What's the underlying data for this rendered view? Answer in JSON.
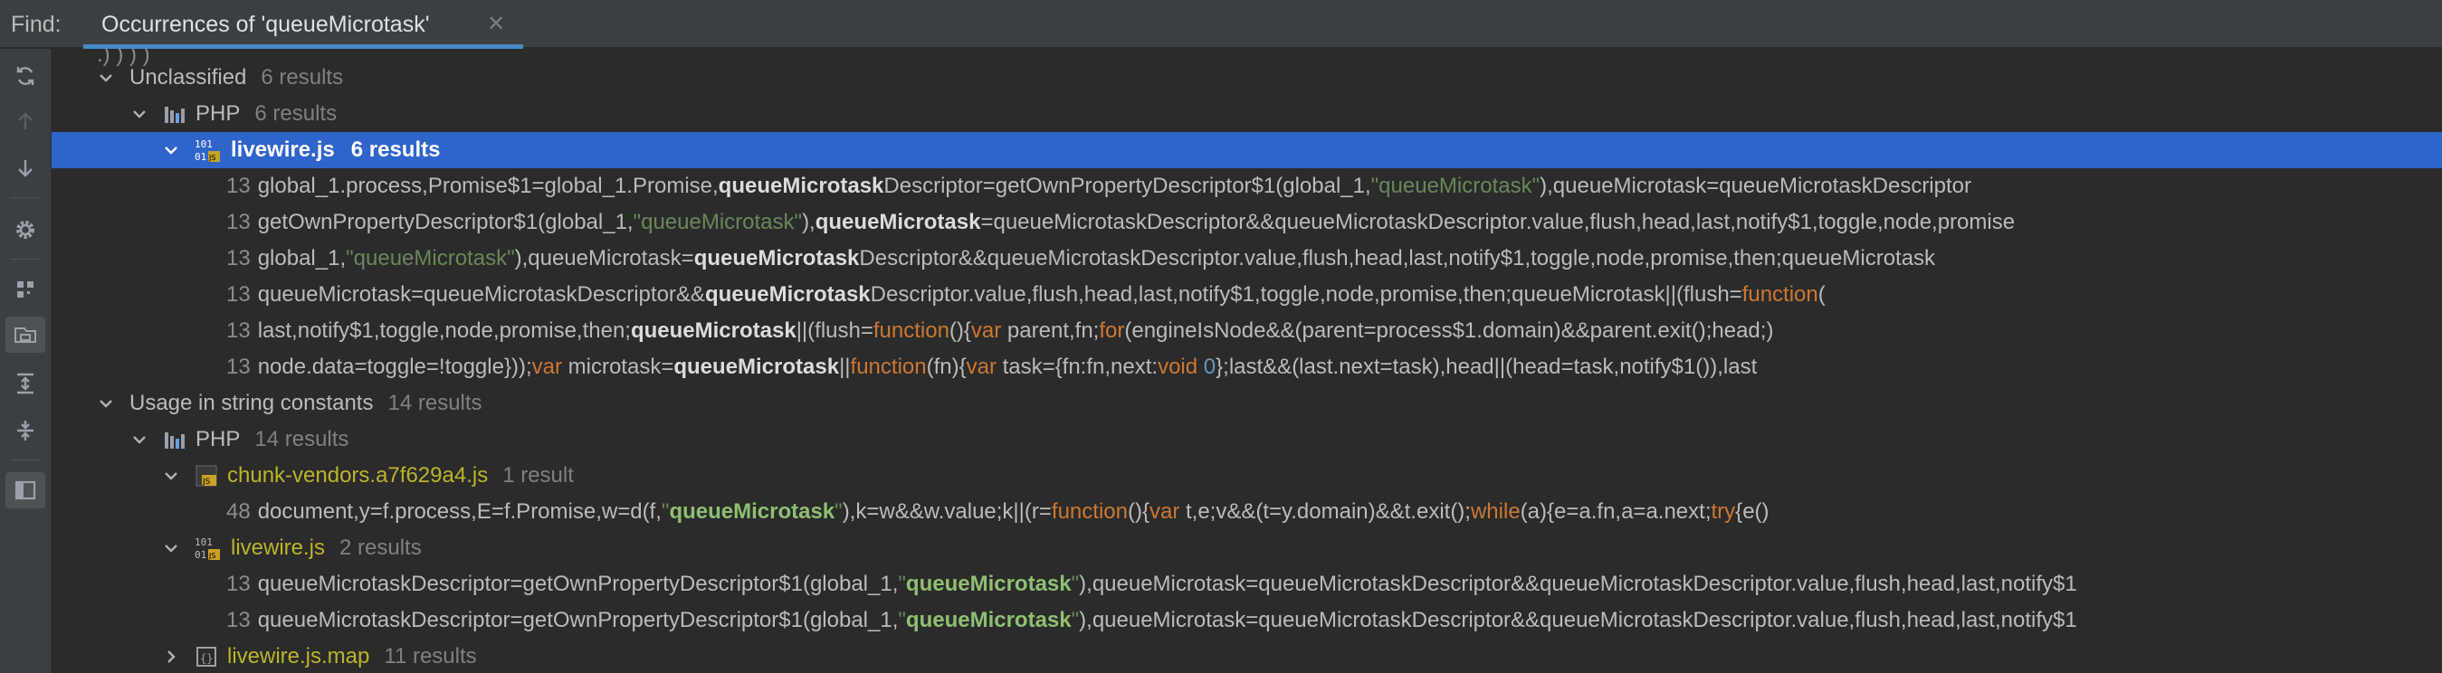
{
  "find_label": "Find:",
  "tab": {
    "title": "Occurrences of 'queueMicrotask'",
    "close": "✕"
  },
  "sidebar": [
    "refresh-icon",
    "arrow-up-icon",
    "arrow-down-icon",
    "gear-icon",
    "group-icon",
    "filter-icon",
    "expand-all-icon",
    "collapse-all-icon",
    "preview-icon"
  ],
  "tree": {
    "unclassified": {
      "label": "Unclassified",
      "count": "6 results"
    },
    "php1": {
      "label": "PHP",
      "count": "6 results"
    },
    "file1": {
      "label": "livewire.js",
      "count": "6 results"
    },
    "usages1": [
      {
        "line": "13",
        "text": "global_1.process,Promise$1=global_1.Promise,queueMicrotaskDescriptor=getOwnPropertyDescriptor$1(global_1,\"queueMicrotask\"),queueMicrotask=queueMicrotaskDescriptor"
      },
      {
        "line": "13",
        "text": "getOwnPropertyDescriptor$1(global_1,\"queueMicrotask\"),queueMicrotask=queueMicrotaskDescriptor&&queueMicrotaskDescriptor.value,flush,head,last,notify$1,toggle,node,promise"
      },
      {
        "line": "13",
        "text": "global_1,\"queueMicrotask\"),queueMicrotask=queueMicrotaskDescriptor&&queueMicrotaskDescriptor.value,flush,head,last,notify$1,toggle,node,promise,then;queueMicrotask"
      },
      {
        "line": "13",
        "text": "queueMicrotask=queueMicrotaskDescriptor&&queueMicrotaskDescriptor.value,flush,head,last,notify$1,toggle,node,promise,then;queueMicrotask||(flush=function("
      },
      {
        "line": "13",
        "text": "last,notify$1,toggle,node,promise,then;queueMicrotask||(flush=function(){var parent,fn;for(engineIsNode&&(parent=process$1.domain)&&parent.exit();head;)"
      },
      {
        "line": "13",
        "text": "node.data=toggle=!toggle}));var microtask=queueMicrotask||function(fn){var task={fn:fn,next:void 0};last&&(last.next=task),head||(head=task,notify$1()),last"
      }
    ],
    "string_constants": {
      "label": "Usage in string constants",
      "count": "14 results"
    },
    "php2": {
      "label": "PHP",
      "count": "14 results"
    },
    "file2": {
      "label": "chunk-vendors.a7f629a4.js",
      "count": "1 result"
    },
    "usages2": [
      {
        "line": "48",
        "text": "document,y=f.process,E=f.Promise,w=d(f,\"queueMicrotask\"),k=w&&w.value;k||(r=function(){var t,e;v&&(t=y.domain)&&t.exit();while(a){e=a.fn,a=a.next;try{e()"
      }
    ],
    "file3": {
      "label": "livewire.js",
      "count": "2 results"
    },
    "usages3": [
      {
        "line": "13",
        "text": "queueMicrotaskDescriptor=getOwnPropertyDescriptor$1(global_1,\"queueMicrotask\"),queueMicrotask=queueMicrotaskDescriptor&&queueMicrotaskDescriptor.value,flush,head,last,notify$1"
      },
      {
        "line": "13",
        "text": "queueMicrotaskDescriptor=getOwnPropertyDescriptor$1(global_1,\"queueMicrotask\"),queueMicrotask=queueMicrotaskDescriptor&&queueMicrotaskDescriptor.value,flush,head,last,notify$1"
      }
    ],
    "file4": {
      "label": "livewire.js.map",
      "count": "11 results"
    }
  }
}
